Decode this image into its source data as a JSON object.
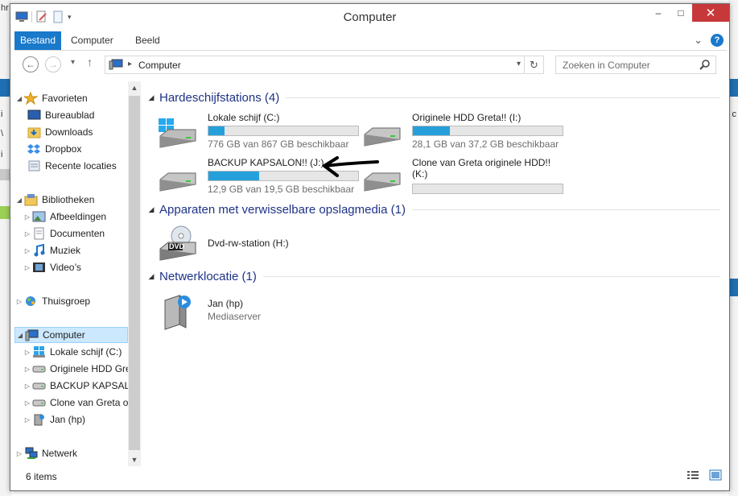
{
  "window": {
    "title": "Computer",
    "minimize": "–",
    "maximize": "□",
    "close": "✕"
  },
  "background": {
    "left_frag1": "hr",
    "left_frag2": "i",
    "left_frag3": "\\",
    "left_frag4": "i",
    "right_frag1": "c"
  },
  "ribbon": {
    "tabs": [
      {
        "label": "Bestand"
      },
      {
        "label": "Computer"
      },
      {
        "label": "Beeld"
      }
    ],
    "help": "?",
    "collapse": "⌄"
  },
  "address": {
    "path": "Computer",
    "refresh": "↻"
  },
  "search": {
    "placeholder": "Zoeken in Computer"
  },
  "nav": {
    "items": [
      {
        "label": "Favorieten"
      },
      {
        "label": "Bureaublad"
      },
      {
        "label": "Downloads"
      },
      {
        "label": "Dropbox"
      },
      {
        "label": "Recente locaties"
      },
      {
        "label": "Bibliotheken"
      },
      {
        "label": "Afbeeldingen"
      },
      {
        "label": "Documenten"
      },
      {
        "label": "Muziek"
      },
      {
        "label": "Video’s"
      },
      {
        "label": "Thuisgroep"
      },
      {
        "label": "Computer"
      },
      {
        "label": "Lokale schijf (C:)"
      },
      {
        "label": "Originele HDD Greta!! (I:)"
      },
      {
        "label": "BACKUP KAPSALON!! (J:)"
      },
      {
        "label": "Clone van Greta originele HDD!! (K:)"
      },
      {
        "label": "Jan (hp)"
      },
      {
        "label": "Netwerk"
      }
    ]
  },
  "groups": {
    "drives": {
      "title": "Hardeschijfstations (4)"
    },
    "removable": {
      "title": "Apparaten met verwisselbare opslagmedia (1)"
    },
    "network": {
      "title": "Netwerklocatie (1)"
    }
  },
  "drives": [
    {
      "name": "Lokale schijf (C:)",
      "space": "776 GB van 867 GB beschikbaar",
      "used_fraction": 0.105
    },
    {
      "name": "Originele HDD Greta!! (I:)",
      "space": "28,1 GB van 37,2 GB beschikbaar",
      "used_fraction": 0.245
    },
    {
      "name": "BACKUP KAPSALON!! (J:)",
      "space": "12,9 GB van 19,5 GB beschikbaar",
      "used_fraction": 0.338
    },
    {
      "name": "Clone van Greta originele HDD!! (K:)",
      "space": "",
      "used_fraction": 0
    }
  ],
  "removable": [
    {
      "name": "Dvd-rw-station (H:)",
      "badge": "DVD"
    }
  ],
  "network": [
    {
      "name": "Jan (hp)",
      "sub": "Mediaserver"
    }
  ],
  "status": {
    "count": "6 items"
  },
  "colors": {
    "accent": "#1979ca",
    "group_title": "#1e3287",
    "bar_fill": "#26a0da",
    "close": "#c7383a"
  }
}
